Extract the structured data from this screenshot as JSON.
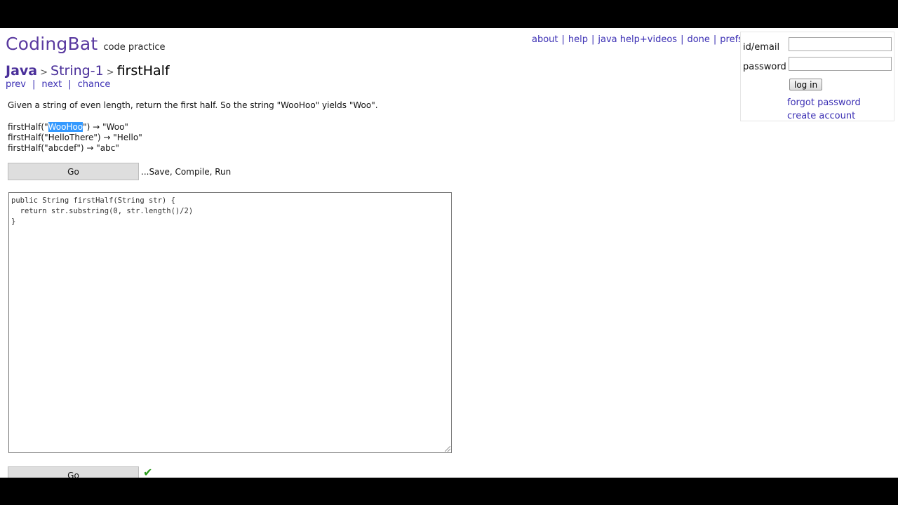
{
  "header": {
    "brand": "CodingBat",
    "tagline": "code practice",
    "links": [
      "about",
      "help",
      "java help+videos",
      "done",
      "prefs"
    ]
  },
  "login": {
    "id_label": "id/email",
    "id_value": "",
    "password_label": "password",
    "password_value": "",
    "login_button": "log in",
    "forgot_link": "forgot password",
    "create_link": "create account"
  },
  "breadcrumb": {
    "language": "Java",
    "section": "String-1",
    "problem": "firstHalf",
    "separator": ">"
  },
  "nav": {
    "prev": "prev",
    "next": "next",
    "chance": "chance",
    "separator": "|"
  },
  "problem": {
    "description": "Given a string of even length, return the first half. So the string \"WooHoo\" yields \"Woo\".",
    "examples": [
      {
        "pre": "firstHalf(\"",
        "selected": "WooHoo",
        "post": "\") → \"Woo\""
      },
      {
        "text": "firstHalf(\"HelloThere\") → \"Hello\""
      },
      {
        "text": "firstHalf(\"abcdef\") → \"abc\""
      }
    ]
  },
  "actions": {
    "go_label": "Go",
    "go_note": "...Save, Compile, Run",
    "go_label_bottom": "Go"
  },
  "editor": {
    "code": "public String firstHalf(String str) {\n  return str.substring(0, str.length()/2)\n}"
  },
  "status": {
    "check_icon": "checkmark-icon",
    "check_color": "#2a9a1a"
  }
}
